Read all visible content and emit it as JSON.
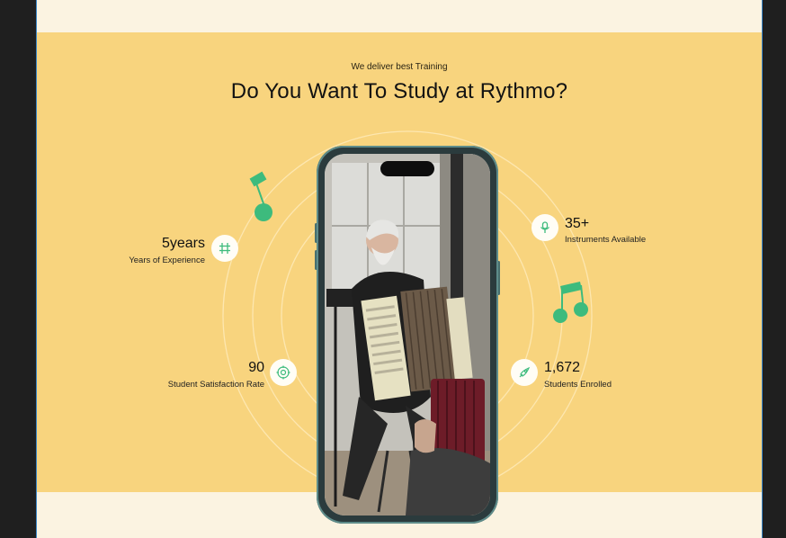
{
  "section": {
    "kicker": "We deliver best Training",
    "title": "Do You Want To Study at Rythmo?"
  },
  "stats": [
    {
      "value": "5years",
      "label": "Years of Experience",
      "icon": "hash-icon"
    },
    {
      "value": "90",
      "label": "Student Satisfaction Rate",
      "icon": "target-icon"
    },
    {
      "value": "35+",
      "label": "Instruments Available",
      "icon": "microphone-icon"
    },
    {
      "value": "1,672",
      "label": "Students Enrolled",
      "icon": "rocket-icon"
    }
  ],
  "colors": {
    "band": "#f8d47e",
    "cream": "#fbf3e1",
    "accent_green": "#3dbb7d",
    "frame": "#1f1f1f"
  },
  "media": {
    "description_icon": "accordion-player-photo"
  }
}
